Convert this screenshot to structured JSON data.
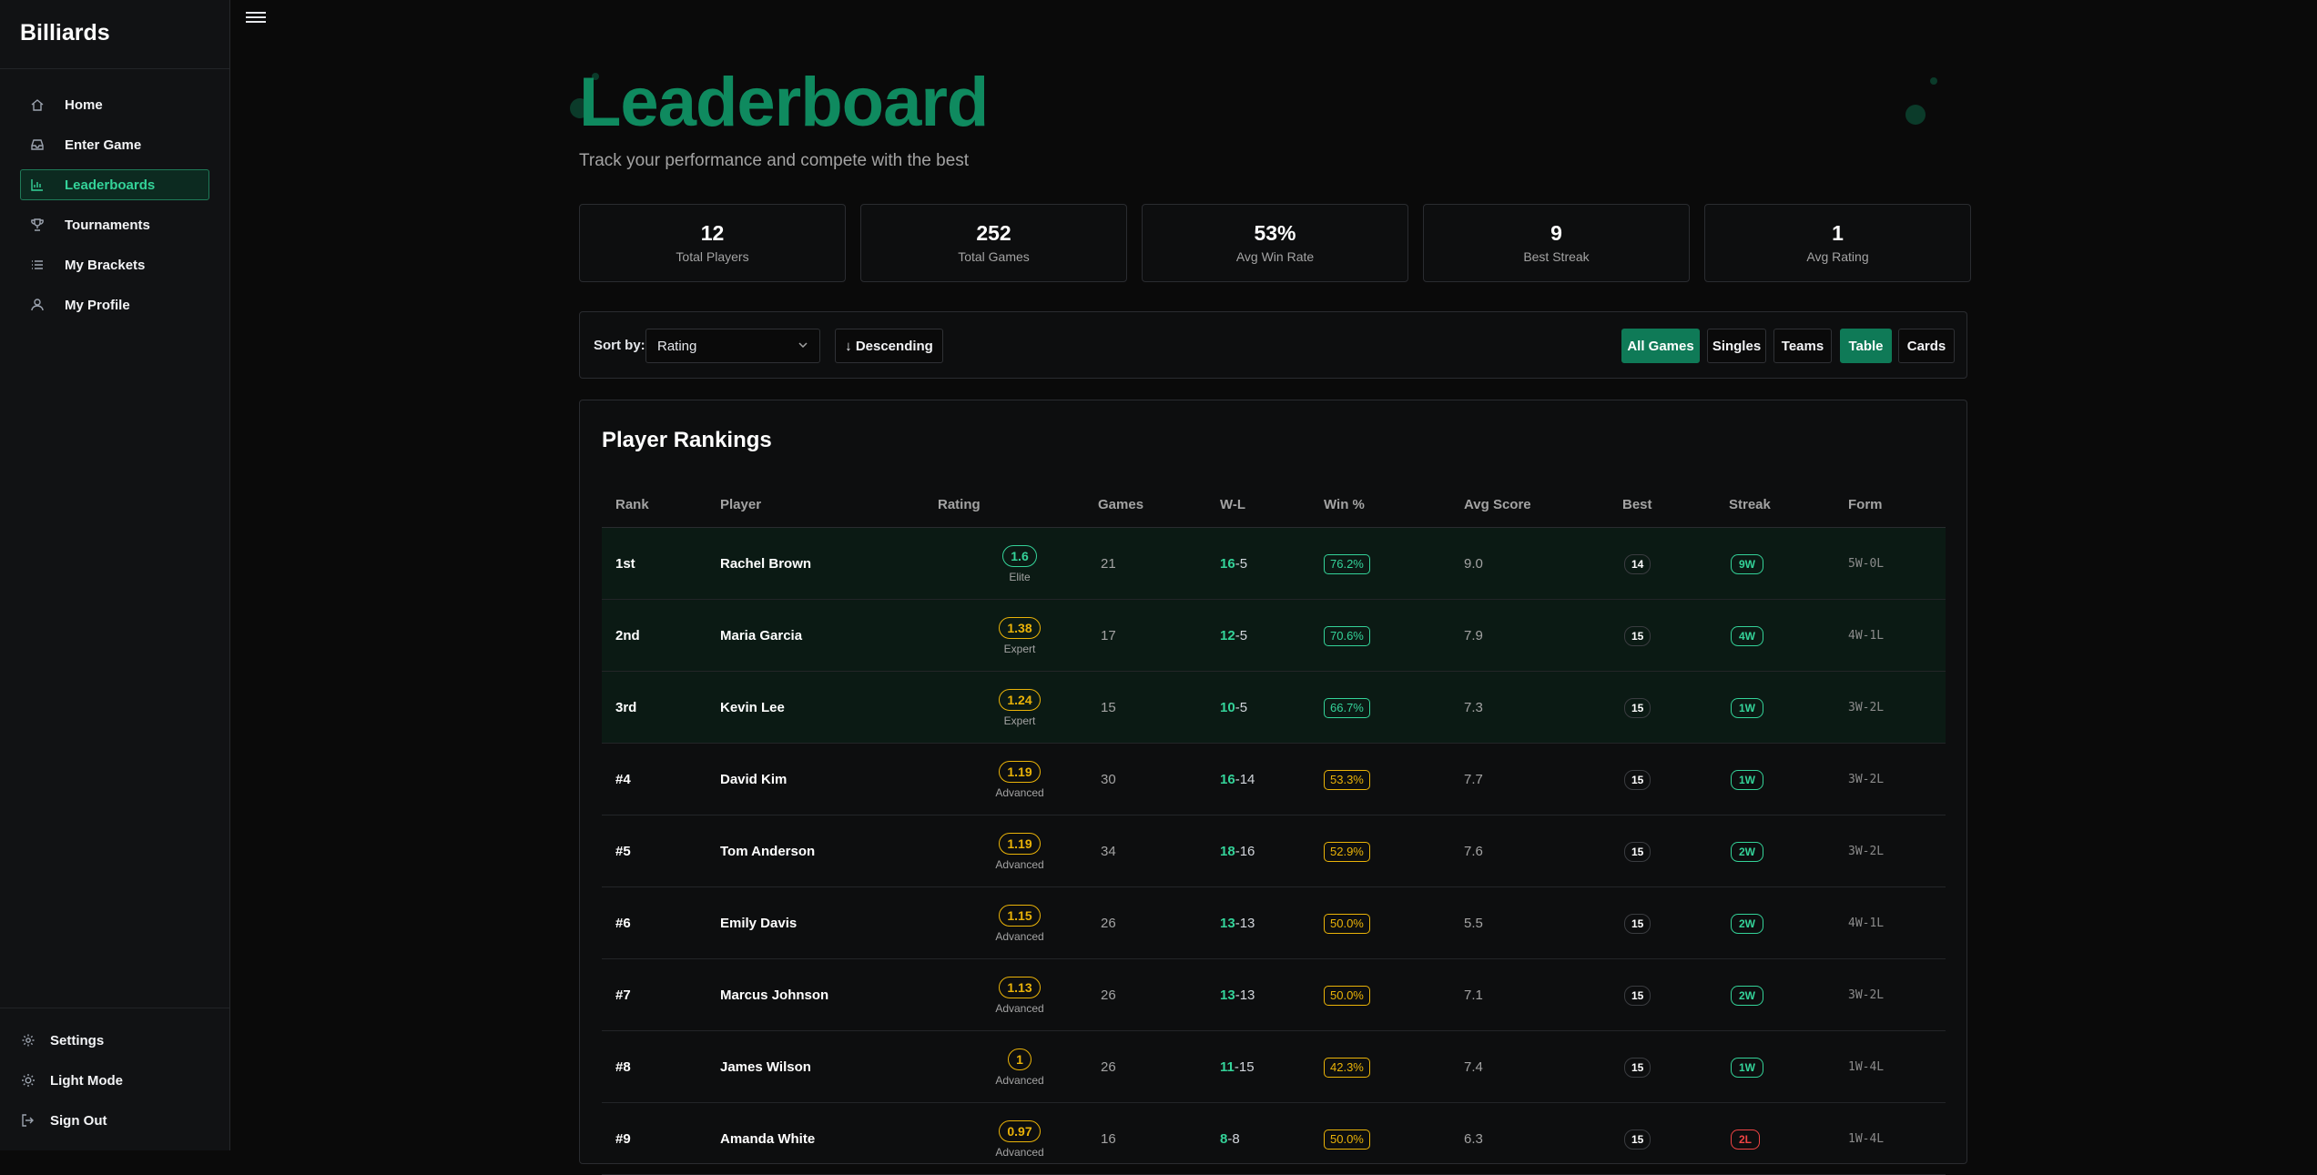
{
  "app": {
    "brand": "Billiards"
  },
  "colors": {
    "accent": "#0f8a5f",
    "win": "#34d399",
    "gold": "#eab308",
    "loss": "#ef4444"
  },
  "sidebar": {
    "items": [
      {
        "label": "Home",
        "icon": "home-icon",
        "active": false
      },
      {
        "label": "Enter Game",
        "icon": "inbox-icon",
        "active": false
      },
      {
        "label": "Leaderboards",
        "icon": "bar-chart-icon",
        "active": true
      },
      {
        "label": "Tournaments",
        "icon": "trophy-icon",
        "active": false
      },
      {
        "label": "My Brackets",
        "icon": "list-icon",
        "active": false
      },
      {
        "label": "My Profile",
        "icon": "user-icon",
        "active": false
      }
    ],
    "bottom": [
      {
        "label": "Settings",
        "icon": "gear-icon"
      },
      {
        "label": "Light Mode",
        "icon": "sun-icon"
      },
      {
        "label": "Sign Out",
        "icon": "sign-out-icon"
      }
    ]
  },
  "header": {
    "title": "Leaderboard",
    "subtitle": "Track your performance and compete with the best"
  },
  "stats": [
    {
      "value": "12",
      "label": "Total Players"
    },
    {
      "value": "252",
      "label": "Total Games"
    },
    {
      "value": "53%",
      "label": "Avg Win Rate"
    },
    {
      "value": "9",
      "label": "Best Streak"
    },
    {
      "value": "1",
      "label": "Avg Rating"
    }
  ],
  "controls": {
    "sort_label": "Sort by:",
    "sort_value": "Rating",
    "order_label": "↓ Descending",
    "filters": [
      "All Games",
      "Singles",
      "Teams"
    ],
    "active_filter": "All Games",
    "views": [
      "Table",
      "Cards"
    ],
    "active_view": "Table"
  },
  "rankings": {
    "title": "Player Rankings",
    "columns": [
      "Rank",
      "Player",
      "Rating",
      "Games",
      "W-L",
      "Win %",
      "Avg Score",
      "Best",
      "Streak",
      "Form"
    ],
    "rows": [
      {
        "rank": "1st",
        "player": "Rachel Brown",
        "rating": "1.6",
        "tier": "Elite",
        "games": "21",
        "wins": "16",
        "losses": "5",
        "win_pct": "76.2%",
        "avg_score": "9.0",
        "best": "14",
        "streak": "9W",
        "form": "5W-0L",
        "top": true
      },
      {
        "rank": "2nd",
        "player": "Maria Garcia",
        "rating": "1.38",
        "tier": "Expert",
        "games": "17",
        "wins": "12",
        "losses": "5",
        "win_pct": "70.6%",
        "avg_score": "7.9",
        "best": "15",
        "streak": "4W",
        "form": "4W-1L",
        "top": true
      },
      {
        "rank": "3rd",
        "player": "Kevin Lee",
        "rating": "1.24",
        "tier": "Expert",
        "games": "15",
        "wins": "10",
        "losses": "5",
        "win_pct": "66.7%",
        "avg_score": "7.3",
        "best": "15",
        "streak": "1W",
        "form": "3W-2L",
        "top": true
      },
      {
        "rank": "#4",
        "player": "David Kim",
        "rating": "1.19",
        "tier": "Advanced",
        "games": "30",
        "wins": "16",
        "losses": "14",
        "win_pct": "53.3%",
        "avg_score": "7.7",
        "best": "15",
        "streak": "1W",
        "form": "3W-2L",
        "top": false
      },
      {
        "rank": "#5",
        "player": "Tom Anderson",
        "rating": "1.19",
        "tier": "Advanced",
        "games": "34",
        "wins": "18",
        "losses": "16",
        "win_pct": "52.9%",
        "avg_score": "7.6",
        "best": "15",
        "streak": "2W",
        "form": "3W-2L",
        "top": false
      },
      {
        "rank": "#6",
        "player": "Emily Davis",
        "rating": "1.15",
        "tier": "Advanced",
        "games": "26",
        "wins": "13",
        "losses": "13",
        "win_pct": "50.0%",
        "avg_score": "5.5",
        "best": "15",
        "streak": "2W",
        "form": "4W-1L",
        "top": false
      },
      {
        "rank": "#7",
        "player": "Marcus Johnson",
        "rating": "1.13",
        "tier": "Advanced",
        "games": "26",
        "wins": "13",
        "losses": "13",
        "win_pct": "50.0%",
        "avg_score": "7.1",
        "best": "15",
        "streak": "2W",
        "form": "3W-2L",
        "top": false
      },
      {
        "rank": "#8",
        "player": "James Wilson",
        "rating": "1",
        "tier": "Advanced",
        "games": "26",
        "wins": "11",
        "losses": "15",
        "win_pct": "42.3%",
        "avg_score": "7.4",
        "best": "15",
        "streak": "1W",
        "form": "1W-4L",
        "top": false
      },
      {
        "rank": "#9",
        "player": "Amanda White",
        "rating": "0.97",
        "tier": "Advanced",
        "games": "16",
        "wins": "8",
        "losses": "8",
        "win_pct": "50.0%",
        "avg_score": "6.3",
        "best": "15",
        "streak": "2L",
        "form": "1W-4L",
        "top": false
      }
    ]
  }
}
